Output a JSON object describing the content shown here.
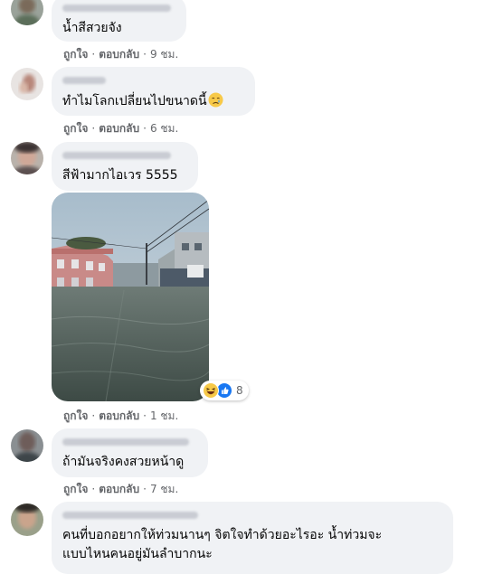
{
  "comments": [
    {
      "text": "น้ำสีสวยจัง",
      "actions": {
        "like": "ถูกใจ",
        "reply": "ตอบกลับ",
        "time": "9 ชม."
      }
    },
    {
      "text": "ทำไมโลกเปลี่ยนไปขนาดนี้",
      "emoji": "crying-face",
      "actions": {
        "like": "ถูกใจ",
        "reply": "ตอบกลับ",
        "time": "6 ชม."
      }
    },
    {
      "text": "สีฟ้ามากไอเวร 5555",
      "has_photo": true,
      "reaction_count": "8",
      "reaction_icons": [
        "haha-reaction-icon",
        "like-reaction-icon"
      ],
      "actions": {
        "like": "ถูกใจ",
        "reply": "ตอบกลับ",
        "time": "1 ชม."
      }
    },
    {
      "text": "ถ้ามันจริงคงสวยหน้าดู",
      "actions": {
        "like": "ถูกใจ",
        "reply": "ตอบกลับ",
        "time": "7 ชม."
      }
    },
    {
      "text_line1": "คนที่บอกอยากให้ท่วมนานๆ จิตใจทำด้วยอะไรอะ น้ำท่วมจะ",
      "text_line2": "แบบไหนคนอยู่มันลำบากนะ"
    }
  ],
  "separator": "·",
  "colors": {
    "bubble": "#f0f2f5",
    "meta": "#65676b",
    "text": "#050505",
    "like_blue": "#1877f2"
  }
}
